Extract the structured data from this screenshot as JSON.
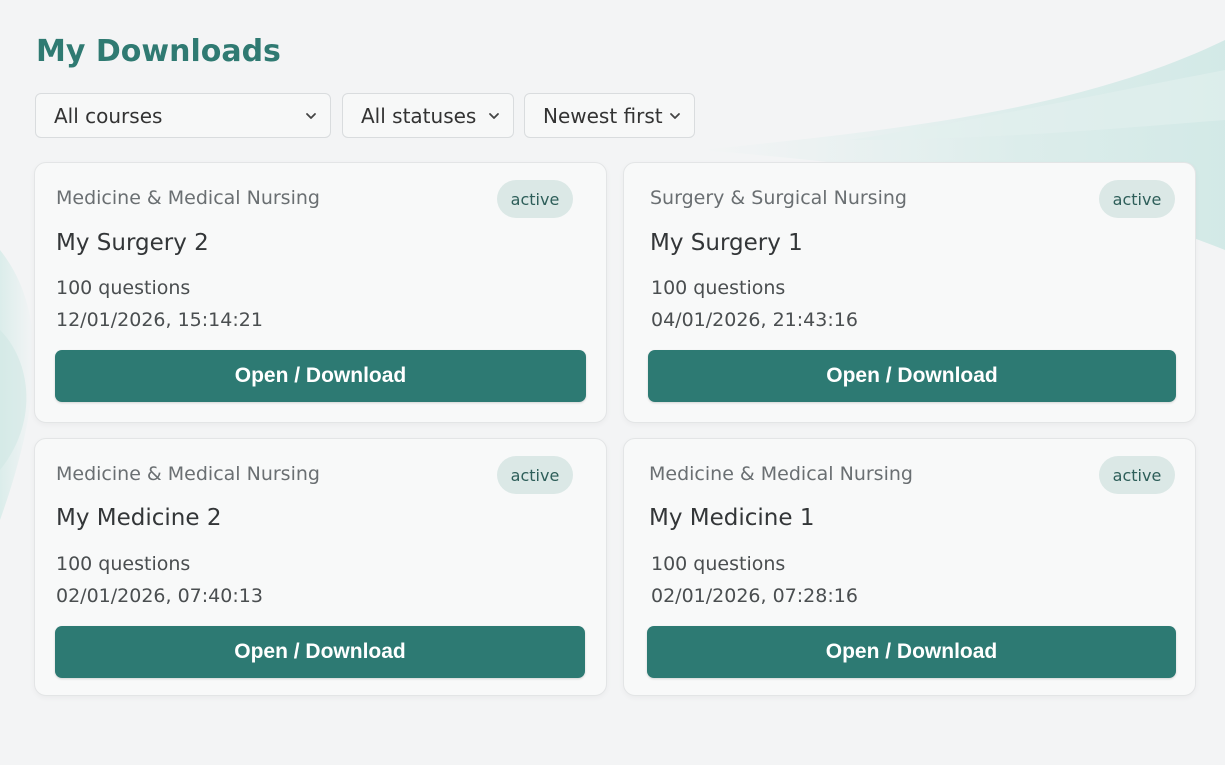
{
  "page": {
    "title": "My Downloads"
  },
  "filters": {
    "course": "All courses",
    "status": "All statuses",
    "sort": "Newest first"
  },
  "cards": [
    {
      "course": "Medicine & Medical Nursing",
      "status": "active",
      "title": "My Surgery 2",
      "questions": "100 questions",
      "date": "12/01/2026, 15:14:21",
      "button": "Open / Download"
    },
    {
      "course": "Surgery & Surgical Nursing",
      "status": "active",
      "title": "My Surgery 1",
      "questions": "100 questions",
      "date": "04/01/2026, 21:43:16",
      "button": "Open / Download"
    },
    {
      "course": "Medicine & Medical Nursing",
      "status": "active",
      "title": "My Medicine 2",
      "questions": "100 questions",
      "date": "02/01/2026, 07:40:13",
      "button": "Open / Download"
    },
    {
      "course": "Medicine & Medical Nursing",
      "status": "active",
      "title": "My Medicine 1",
      "questions": "100 questions",
      "date": "02/01/2026, 07:28:16",
      "button": "Open / Download"
    }
  ],
  "colors": {
    "accent": "#2d7a73",
    "title": "#2f7a72",
    "badge_bg": "#dbe8e6",
    "badge_text": "#2d5e59"
  },
  "icons": {
    "dropdown": "chevron-down-icon"
  }
}
